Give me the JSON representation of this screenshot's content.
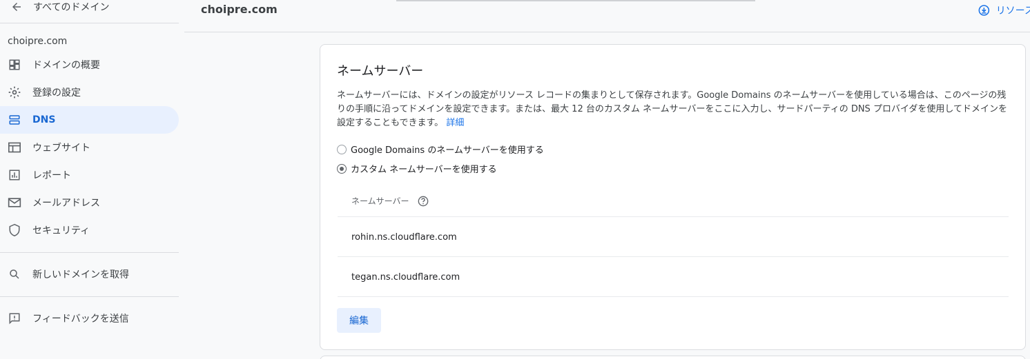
{
  "sidebar": {
    "back_label": "すべてのドメイン",
    "domain": "choipre.com",
    "items": [
      {
        "label": "ドメインの概要",
        "icon": "dashboard-icon"
      },
      {
        "label": "登録の設定",
        "icon": "gear-icon"
      },
      {
        "label": "DNS",
        "icon": "dns-icon",
        "active": true
      },
      {
        "label": "ウェブサイト",
        "icon": "web-icon"
      },
      {
        "label": "レポート",
        "icon": "chart-icon"
      },
      {
        "label": "メールアドレス",
        "icon": "mail-icon"
      },
      {
        "label": "セキュリティ",
        "icon": "shield-icon"
      }
    ],
    "new_domain_label": "新しいドメインを取得",
    "feedback_label": "フィードバックを送信"
  },
  "header": {
    "title": "choipre.com",
    "resource_label": "リソース"
  },
  "nameserver_card": {
    "heading": "ネームサーバー",
    "description": "ネームサーバーには、ドメインの設定がリソース レコードの集まりとして保存されます。Google Domains のネームサーバーを使用している場合は、このページの残りの手順に沿ってドメインを設定できます。または、最大 12 台のカスタム ネームサーバーをここに入力し、サードパーティの DNS プロバイダを使用してドメインを設定することもできます。",
    "details_link": "詳細",
    "option_google": "Google Domains のネームサーバーを使用する",
    "option_custom": "カスタム ネームサーバーを使用する",
    "selected_option": "custom",
    "column_header": "ネームサーバー",
    "nameservers": [
      "rohin.ns.cloudflare.com",
      "tegan.ns.cloudflare.com"
    ],
    "edit_label": "編集"
  },
  "colors": {
    "accent": "#1a73e8",
    "active_bg": "#e8f0fe"
  }
}
